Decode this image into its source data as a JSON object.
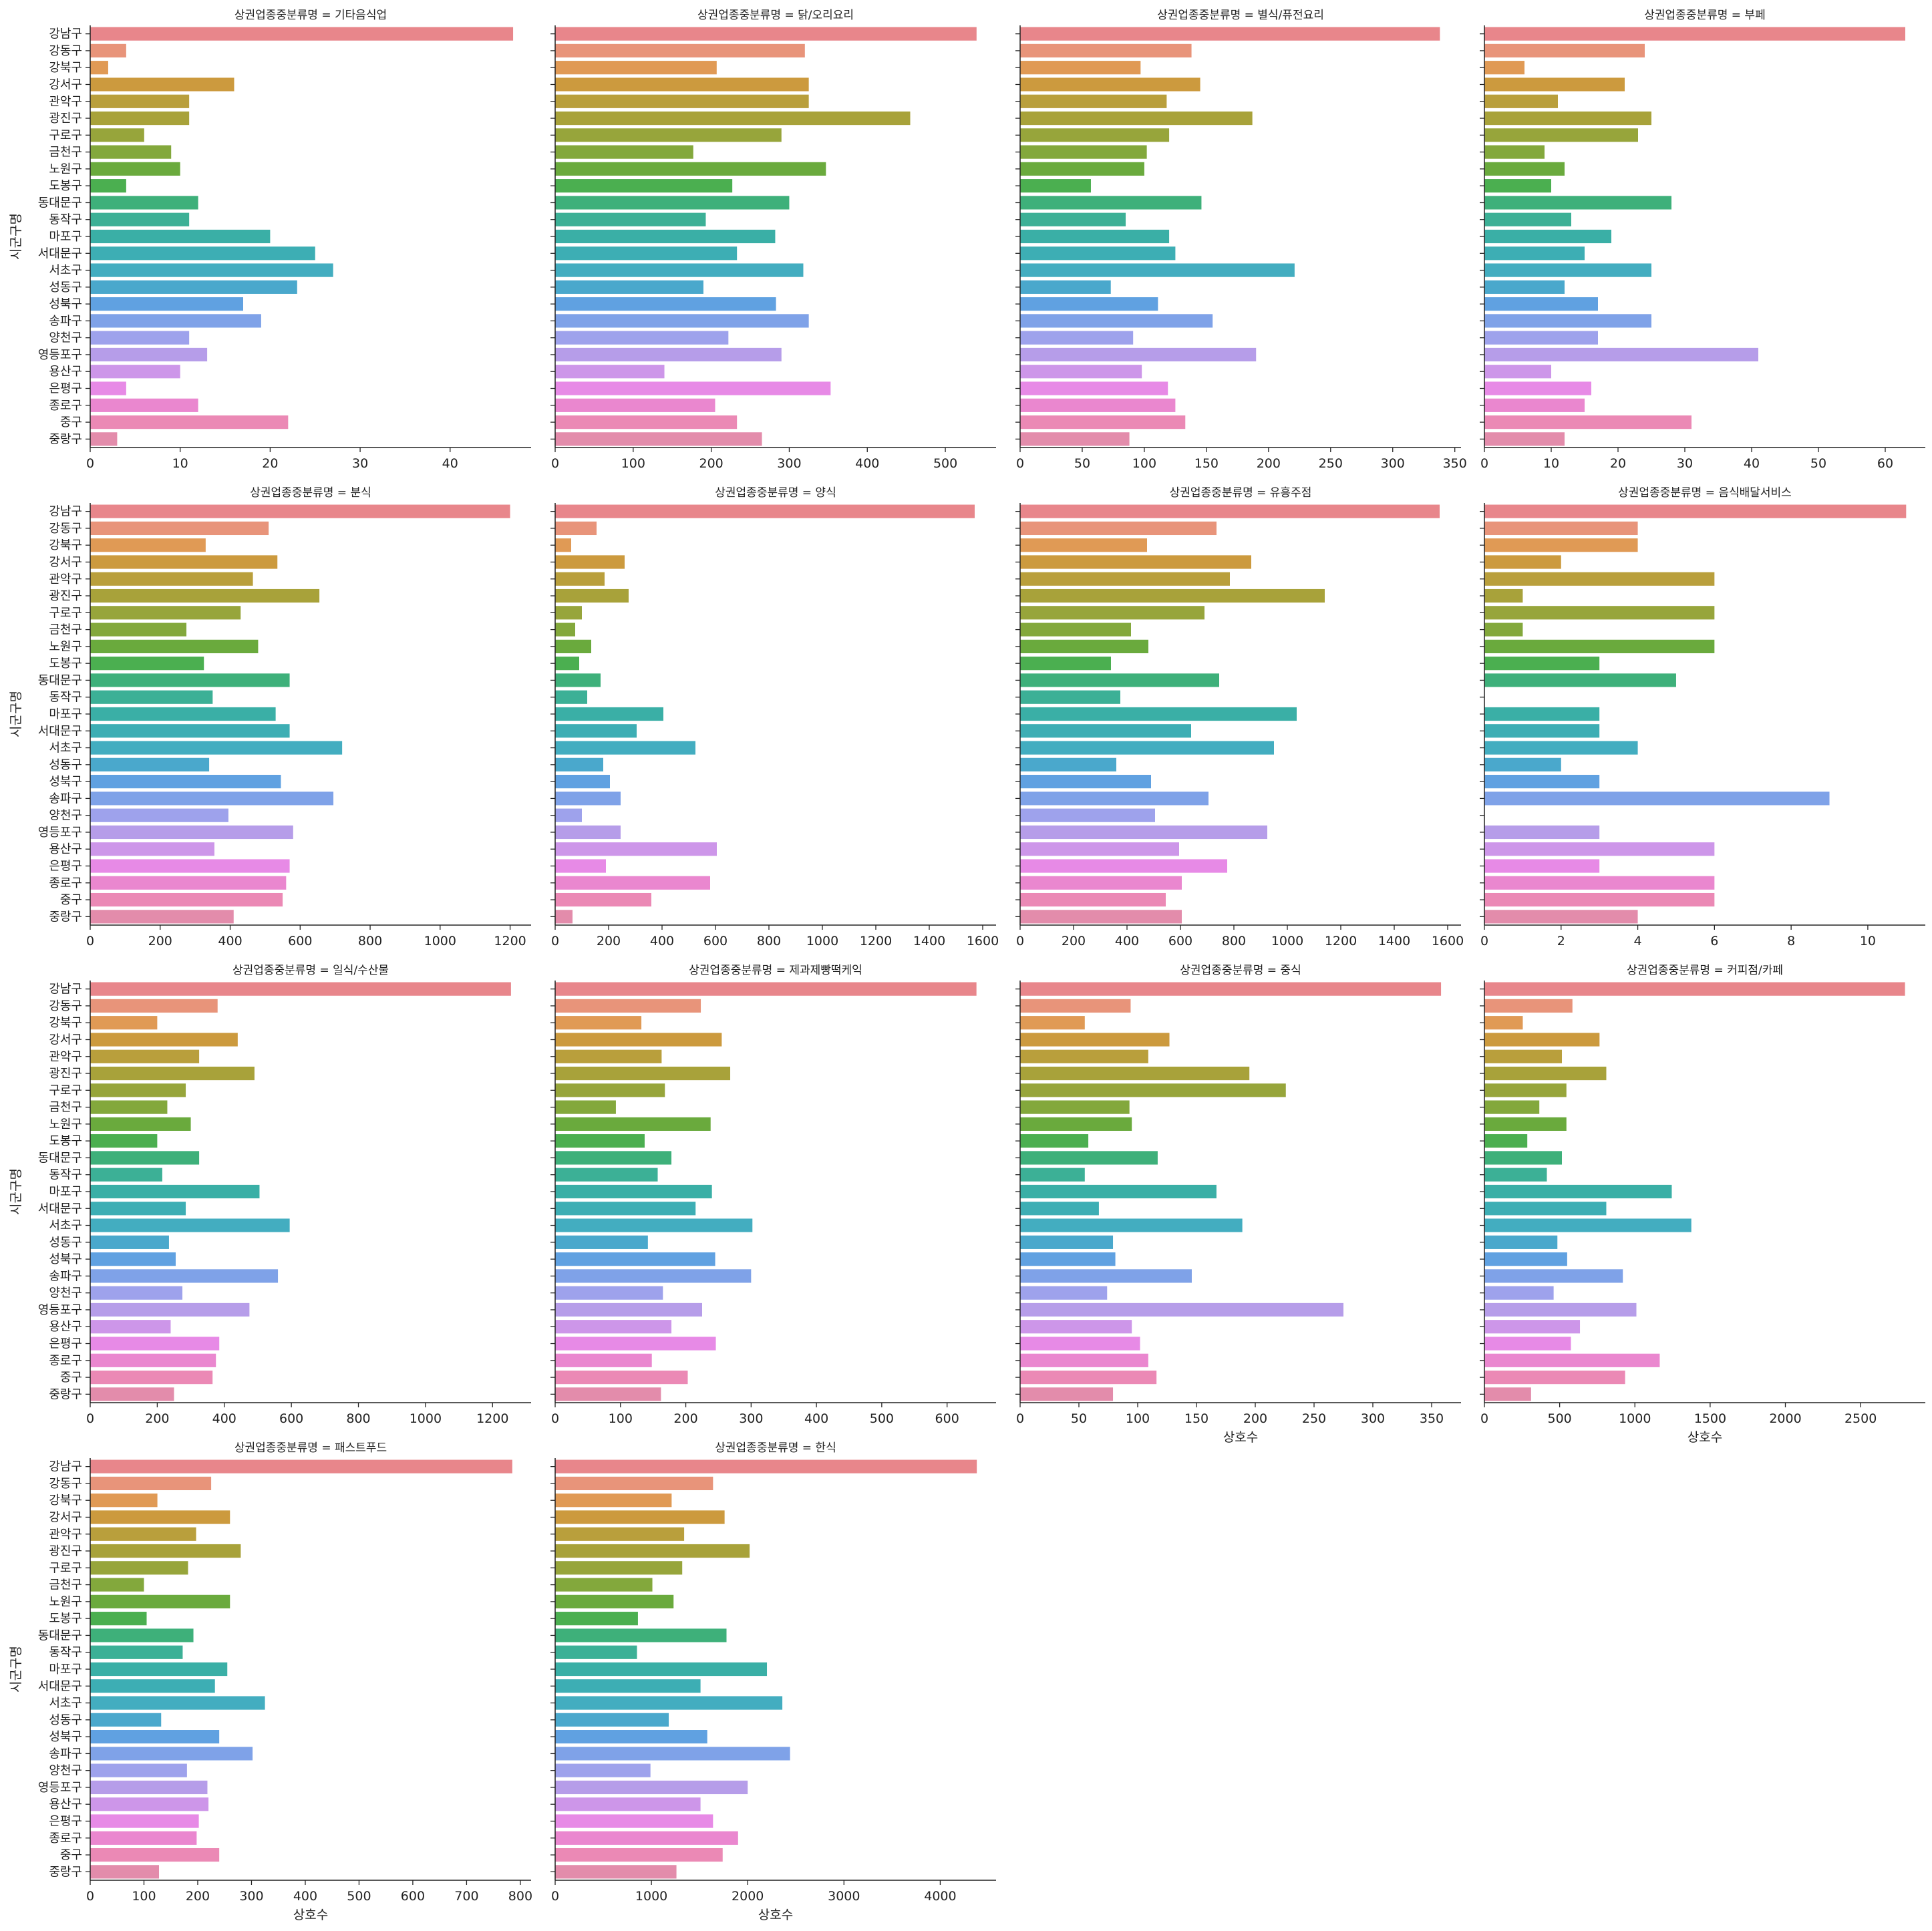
{
  "chart_data": {
    "type": "bar",
    "orientation": "horizontal",
    "layout": "facet-grid 4x4",
    "facet_variable": "상권업종중분류명",
    "ylabel": "시군구명",
    "xlabel": "상호수",
    "grid": false,
    "legend": "none",
    "categories": [
      "강남구",
      "강동구",
      "강북구",
      "강서구",
      "관악구",
      "광진구",
      "구로구",
      "금천구",
      "노원구",
      "도봉구",
      "동대문구",
      "동작구",
      "마포구",
      "서대문구",
      "서초구",
      "성동구",
      "성북구",
      "송파구",
      "양천구",
      "영등포구",
      "용산구",
      "은평구",
      "종로구",
      "중구",
      "중랑구"
    ],
    "colors": [
      "#e8868b",
      "#e8947a",
      "#e09a55",
      "#cc9a3e",
      "#b99f3c",
      "#a8a23a",
      "#97a53b",
      "#83a83c",
      "#6aaa3d",
      "#4baf50",
      "#3eb07a",
      "#3cb096",
      "#3aafa6",
      "#3daeb4",
      "#43adc0",
      "#4aa8cc",
      "#60a1e1",
      "#7fa2e8",
      "#9ea2ec",
      "#b69de9",
      "#cd96e9",
      "#e78ae6",
      "#ea87cf",
      "#eb89b5",
      "#e38cab"
    ],
    "panels": [
      {
        "title": "상권업종중분류명 = 기타음식업",
        "xlim": [
          0,
          49
        ],
        "xticks": [
          0,
          10,
          20,
          30,
          40
        ],
        "values": [
          47,
          4,
          2,
          16,
          11,
          11,
          6,
          9,
          10,
          4,
          12,
          11,
          20,
          25,
          27,
          23,
          17,
          19,
          11,
          13,
          10,
          4,
          12,
          22,
          3
        ]
      },
      {
        "title": "상권업종중분류명 = 닭/오리요리",
        "xlim": [
          0,
          565
        ],
        "xticks": [
          0,
          100,
          200,
          300,
          400,
          500
        ],
        "values": [
          540,
          320,
          207,
          325,
          325,
          455,
          290,
          177,
          347,
          227,
          300,
          193,
          282,
          233,
          318,
          190,
          283,
          325,
          222,
          290,
          140,
          353,
          205,
          233,
          265
        ]
      },
      {
        "title": "상권업종중분류명 = 별식/퓨전요리",
        "xlim": [
          0,
          355
        ],
        "xticks": [
          0,
          50,
          100,
          150,
          200,
          250,
          300,
          350
        ],
        "values": [
          338,
          138,
          97,
          145,
          118,
          187,
          120,
          102,
          100,
          57,
          146,
          85,
          120,
          125,
          221,
          73,
          111,
          155,
          91,
          190,
          98,
          119,
          125,
          133,
          88
        ]
      },
      {
        "title": "상권업종중분류명 = 부페",
        "xlim": [
          0,
          66
        ],
        "xticks": [
          0,
          10,
          20,
          30,
          40,
          50,
          60
        ],
        "values": [
          63,
          24,
          6,
          21,
          11,
          25,
          23,
          9,
          12,
          10,
          28,
          13,
          19,
          15,
          25,
          12,
          17,
          25,
          17,
          41,
          10,
          16,
          15,
          31,
          12
        ]
      },
      {
        "title": "상권업종중분류명 = 분식",
        "xlim": [
          0,
          1260
        ],
        "xticks": [
          0,
          200,
          400,
          600,
          800,
          1000,
          1200
        ],
        "values": [
          1200,
          510,
          330,
          535,
          465,
          655,
          430,
          275,
          480,
          325,
          570,
          350,
          530,
          570,
          720,
          340,
          545,
          695,
          395,
          580,
          355,
          570,
          560,
          550,
          410
        ]
      },
      {
        "title": "상권업종중분류명 = 양식",
        "xlim": [
          0,
          1650
        ],
        "xticks": [
          0,
          200,
          400,
          600,
          800,
          1000,
          1200,
          1400,
          1600
        ],
        "values": [
          1570,
          155,
          60,
          260,
          185,
          275,
          100,
          75,
          135,
          90,
          170,
          120,
          405,
          305,
          525,
          180,
          205,
          245,
          100,
          245,
          605,
          190,
          580,
          360,
          65
        ]
      },
      {
        "title": "상권업종중분류명 = 유흥주점",
        "xlim": [
          0,
          1650
        ],
        "xticks": [
          0,
          200,
          400,
          600,
          800,
          1000,
          1200,
          1400,
          1600
        ],
        "values": [
          1570,
          735,
          475,
          865,
          785,
          1140,
          690,
          415,
          480,
          340,
          745,
          375,
          1035,
          640,
          950,
          360,
          490,
          705,
          505,
          925,
          595,
          775,
          605,
          545,
          605
        ]
      },
      {
        "title": "상권업종중분류명 = 음식배달서비스",
        "xlim": [
          0,
          11.5
        ],
        "xticks": [
          0,
          2,
          4,
          6,
          8,
          10
        ],
        "values": [
          11,
          4,
          4,
          2,
          6,
          1,
          6,
          1,
          6,
          3,
          5,
          0,
          3,
          3,
          4,
          2,
          3,
          9,
          0,
          3,
          6,
          3,
          6,
          6,
          4
        ]
      },
      {
        "title": "상권업종중분류명 = 일식/수산물",
        "xlim": [
          0,
          1315
        ],
        "xticks": [
          0,
          200,
          400,
          600,
          800,
          1000,
          1200
        ],
        "values": [
          1255,
          380,
          200,
          440,
          325,
          490,
          285,
          230,
          300,
          200,
          325,
          215,
          505,
          285,
          595,
          235,
          255,
          560,
          275,
          475,
          240,
          385,
          375,
          365,
          250
        ]
      },
      {
        "title": "상권업종중분류명 = 제과제빵떡케익",
        "xlim": [
          0,
          675
        ],
        "xticks": [
          0,
          100,
          200,
          300,
          400,
          500,
          600
        ],
        "values": [
          645,
          223,
          132,
          255,
          163,
          268,
          168,
          93,
          238,
          137,
          178,
          157,
          240,
          215,
          302,
          142,
          245,
          300,
          165,
          225,
          178,
          246,
          148,
          203,
          162
        ]
      },
      {
        "title": "상권업종중분류명 = 중식",
        "xlim": [
          0,
          375
        ],
        "xticks": [
          0,
          50,
          100,
          150,
          200,
          250,
          300,
          350
        ],
        "values": [
          358,
          94,
          55,
          127,
          109,
          195,
          226,
          93,
          95,
          58,
          117,
          55,
          167,
          67,
          189,
          79,
          81,
          146,
          74,
          275,
          95,
          102,
          109,
          116,
          79
        ]
      },
      {
        "title": "상권업종중분류명 = 커피점/카페",
        "xlim": [
          0,
          2930
        ],
        "xticks": [
          0,
          500,
          1000,
          1500,
          2000,
          2500
        ],
        "values": [
          2795,
          585,
          255,
          765,
          515,
          810,
          545,
          365,
          545,
          285,
          515,
          415,
          1245,
          810,
          1375,
          485,
          550,
          920,
          460,
          1010,
          635,
          575,
          1165,
          935,
          310
        ]
      },
      {
        "title": "상권업종중분류명 = 패스트푸드",
        "xlim": [
          0,
          820
        ],
        "xticks": [
          0,
          100,
          200,
          300,
          400,
          500,
          600,
          700,
          800
        ],
        "values": [
          785,
          225,
          125,
          260,
          197,
          280,
          182,
          100,
          260,
          105,
          192,
          172,
          255,
          232,
          325,
          132,
          240,
          302,
          180,
          218,
          220,
          202,
          198,
          240,
          128
        ]
      },
      {
        "title": "상권업종중분류명 = 한식",
        "xlim": [
          0,
          4580
        ],
        "xticks": [
          0,
          1000,
          2000,
          3000,
          4000
        ],
        "values": [
          4380,
          1640,
          1210,
          1760,
          1340,
          2020,
          1320,
          1010,
          1230,
          860,
          1780,
          850,
          2200,
          1510,
          2360,
          1180,
          1580,
          2440,
          990,
          2000,
          1510,
          1640,
          1900,
          1740,
          1260
        ]
      }
    ]
  }
}
